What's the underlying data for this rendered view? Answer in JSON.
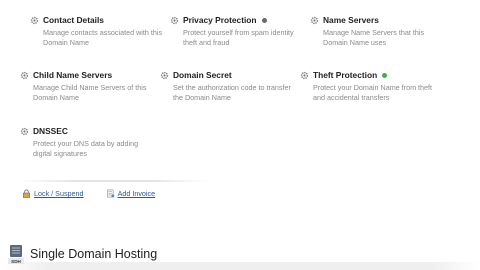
{
  "options": [
    {
      "title": "Contact Details",
      "desc": "Manage contacts associated with this Domain Name",
      "status": ""
    },
    {
      "title": "Privacy Protection",
      "desc": "Protect yourself from spam identity theft and fraud",
      "status": "#6b6b6b"
    },
    {
      "title": "Name Servers",
      "desc": "Manage Name Servers that this Domain Name uses",
      "status": ""
    },
    {
      "title": "Child Name Servers",
      "desc": "Manage Child Name Servers of this Domain Name",
      "status": ""
    },
    {
      "title": "Domain Secret",
      "desc": "Set the authorization code to transfer the Domain Name",
      "status": ""
    },
    {
      "title": "Theft Protection",
      "desc": "Protect your Domain Name from theft and accidental transfers",
      "status": "#3cb043"
    },
    {
      "title": "DNSSEC",
      "desc": "Protect your DNS data by adding digital signatures",
      "status": ""
    }
  ],
  "actions": {
    "lock_label": "Lock / Suspend",
    "invoice_label": "Add Invoice"
  },
  "hosting": {
    "icon_text": "SDH",
    "title": "Single Domain Hosting"
  },
  "icons": {
    "option": "gear-icon",
    "lock": "lock-icon",
    "invoice": "invoice-icon",
    "hosting": "server-icon"
  },
  "colors": {
    "link": "#2a5a9c",
    "status_on": "#3cb043",
    "status_off": "#6b6b6b"
  }
}
